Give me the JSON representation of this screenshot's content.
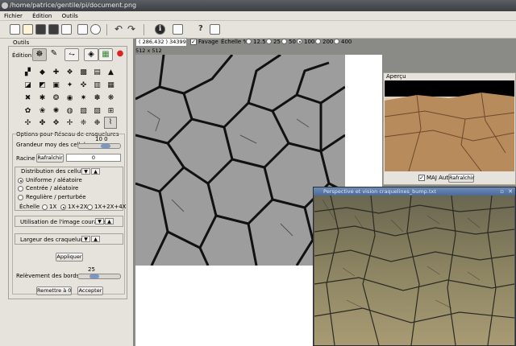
{
  "window": {
    "title": "/home/patrice/gentile/pi/document.png"
  },
  "menu": {
    "items": [
      "Fichier",
      "Édition",
      "Outils"
    ]
  },
  "toolbar": {
    "buttons": [
      "new-icon",
      "open-icon",
      "save-icon",
      "save-as-icon",
      "export-icon",
      "print-icon",
      "info-icon",
      "undo-icon",
      "redo-icon",
      "info2-icon",
      "camera-icon",
      "help-icon",
      "screenshot-icon"
    ],
    "undo_glyph": "↶",
    "redo_glyph": "↷",
    "info_glyph": "ℹ",
    "help_glyph": "?"
  },
  "infobar": {
    "coords": "( 286,432 ) 34399",
    "favage_label": "Favage",
    "echelle_label": "Échelle %",
    "zoom_options": [
      "12.5",
      "25",
      "50",
      "100",
      "200",
      "400"
    ],
    "zoom_selected": "100"
  },
  "canvas": {
    "size": "512 x 512"
  },
  "left_panel": {
    "group_title": "Outils",
    "edition_label": "Édition",
    "options_title": "Options pour Réseau de craquelures",
    "grandeur_label": "Grandeur moy des cellules",
    "grandeur_value": "10 0",
    "racine_label": "Racine",
    "refresh_button": "Rafraîchir",
    "racine_value": "0",
    "distribution_label": "Distribution des cellules",
    "dist_options": [
      "Uniforme / aléatoire",
      "Centrée / aléatoire",
      "Regulière / perturbée"
    ],
    "dist_selected": 0,
    "echelle_label": "Échelle",
    "echelle_options": [
      "1X",
      "1X+2X",
      "1X+2X+4X"
    ],
    "echelle_selected": 1,
    "utilisation_label": "Utilisation de l'image courante",
    "largeur_label": "Largeur des craquelures",
    "appliquer_button": "Appliquer",
    "relevement_value": "25",
    "relevement_label": "Relèvement des bords",
    "reset_button": "Remettre à 0",
    "accept_button": "Accepter"
  },
  "preview": {
    "title": "Aperçu",
    "maj_auto_label": "MAJ Auto",
    "refresh_button": "Rafraîchir"
  },
  "view3d": {
    "title": "Perspective et vision craquelines_bump.txt"
  }
}
